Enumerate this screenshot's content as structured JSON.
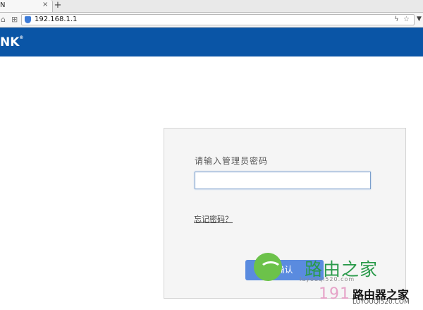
{
  "browser": {
    "tab_title": "N",
    "tab_close": "×",
    "new_tab": "+",
    "url": "192.168.1.1",
    "home_icon": "home-icon",
    "apps_icon": "apps-icon",
    "bolt_icon": "lightning-icon",
    "star_icon": "star-icon",
    "menu_icon": "chevron-down-icon"
  },
  "header": {
    "logo_text": "NK",
    "logo_mark": "®",
    "background_color": "#0a55a6"
  },
  "login": {
    "prompt": "请输入管理员密码",
    "password_value": "",
    "forgot_link": "忘记密码？",
    "confirm_button": "确认",
    "accent_color": "#5a8bdf"
  },
  "watermark": {
    "title": "路由之家",
    "subtitle": "luyouqi520.com",
    "ip_partial": "191",
    "brand": "路由器之家",
    "url": "LUYOUQI520.COM"
  }
}
